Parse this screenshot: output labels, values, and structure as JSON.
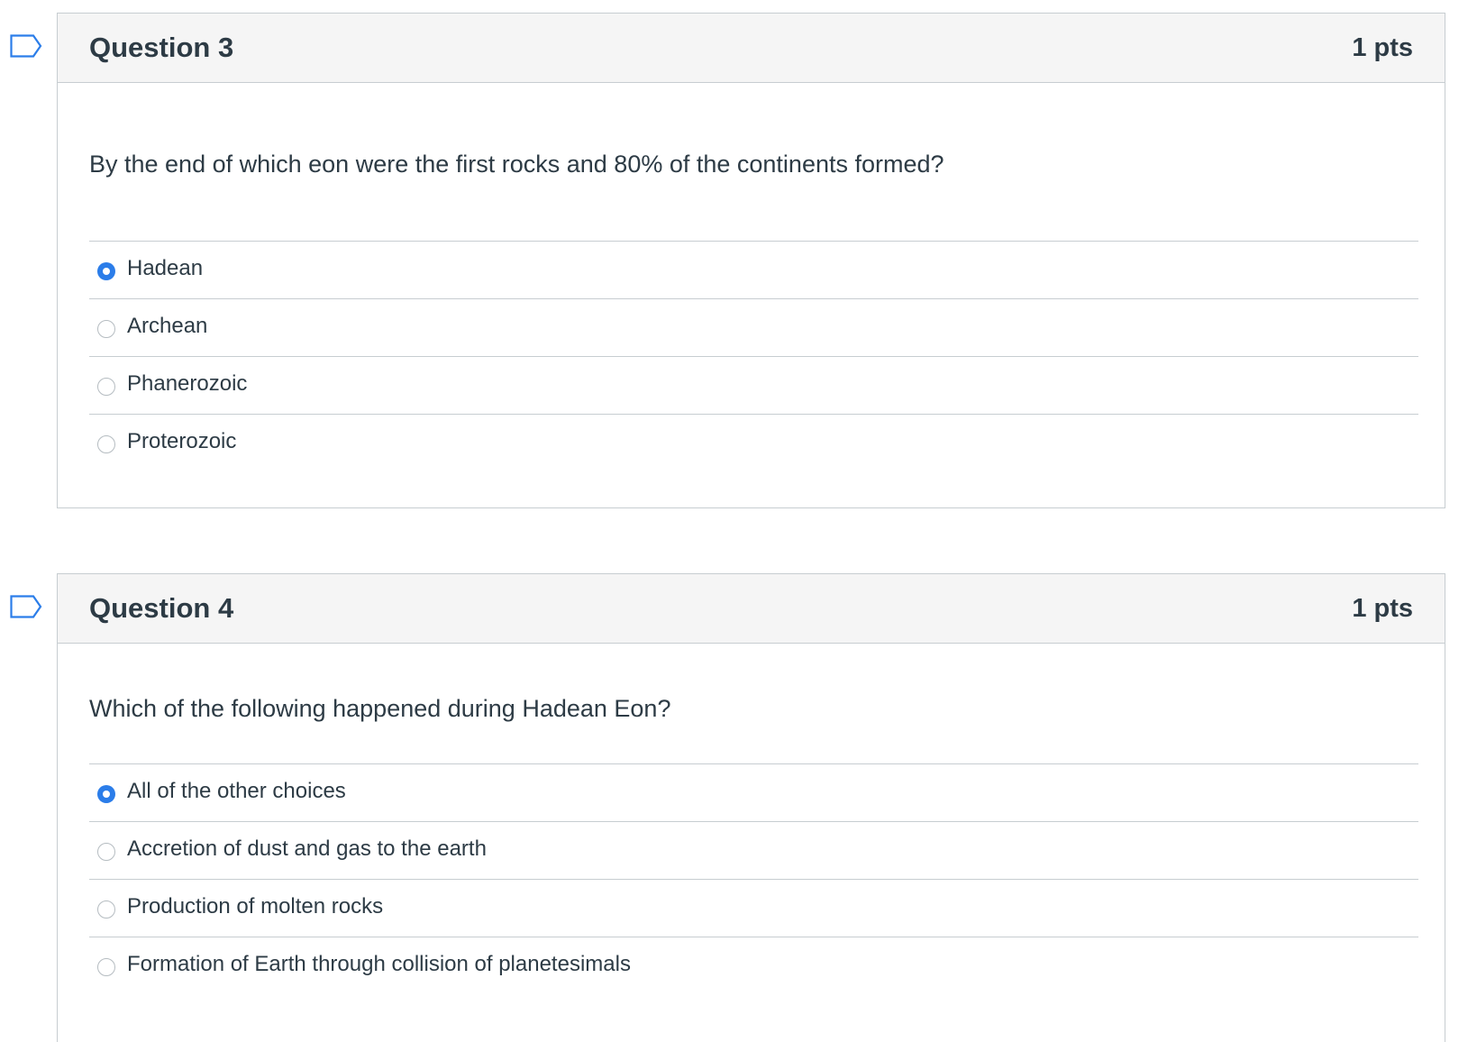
{
  "colors": {
    "accent": "#2b7de9",
    "border": "#c7cdd1",
    "header_bg": "#f5f5f5",
    "text": "#2d3b45"
  },
  "questions": [
    {
      "title": "Question 3",
      "points": "1 pts",
      "text": "By the end of which eon were the first rocks and 80% of the continents formed?",
      "flag_icon": "flag-outline-icon",
      "answers": [
        {
          "label": "Hadean",
          "selected": true
        },
        {
          "label": "Archean",
          "selected": false
        },
        {
          "label": "Phanerozoic",
          "selected": false
        },
        {
          "label": "Proterozoic",
          "selected": false
        }
      ]
    },
    {
      "title": "Question 4",
      "points": "1 pts",
      "text": "Which of the following happened during Hadean Eon?",
      "flag_icon": "flag-outline-icon",
      "answers": [
        {
          "label": "All of the other choices",
          "selected": true
        },
        {
          "label": "Accretion of dust and gas to the earth",
          "selected": false
        },
        {
          "label": "Production of molten rocks",
          "selected": false
        },
        {
          "label": "Formation of Earth through collision of planetesimals",
          "selected": false
        }
      ]
    }
  ]
}
